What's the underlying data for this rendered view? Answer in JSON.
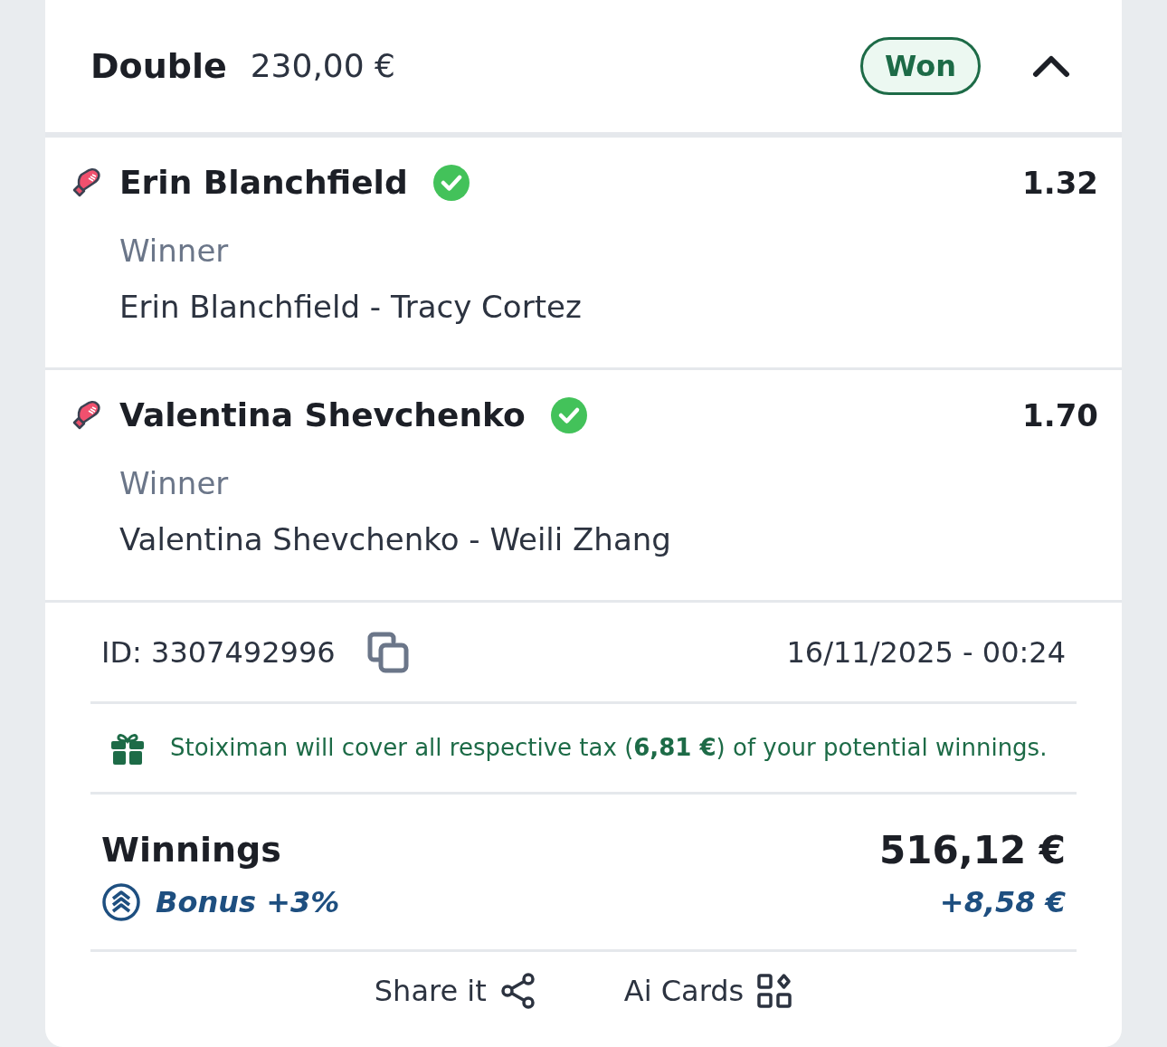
{
  "bet": {
    "type": "Double",
    "stake": "230,00 €",
    "status": "Won",
    "expanded": true
  },
  "selections": [
    {
      "name": "Erin Blanchfield",
      "won": true,
      "odds": "1.32",
      "market": "Winner",
      "event": "Erin Blanchfield - Tracy Cortez"
    },
    {
      "name": "Valentina Shevchenko",
      "won": true,
      "odds": "1.70",
      "market": "Winner",
      "event": "Valentina Shevchenko - Weili Zhang"
    }
  ],
  "details": {
    "id": "ID: 3307492996",
    "date": "16/11/2025 - 00:24",
    "tax_note": "Stoiximan will cover all respective tax (**6,81 €**) of your potential winnings."
  },
  "winnings": {
    "label": "Winnings",
    "amount": "516,12 €",
    "bonus_label": "Bonus +3%",
    "bonus_amount": "+8,58 €"
  },
  "actions": [
    "Share it",
    "Ai Cards"
  ]
}
